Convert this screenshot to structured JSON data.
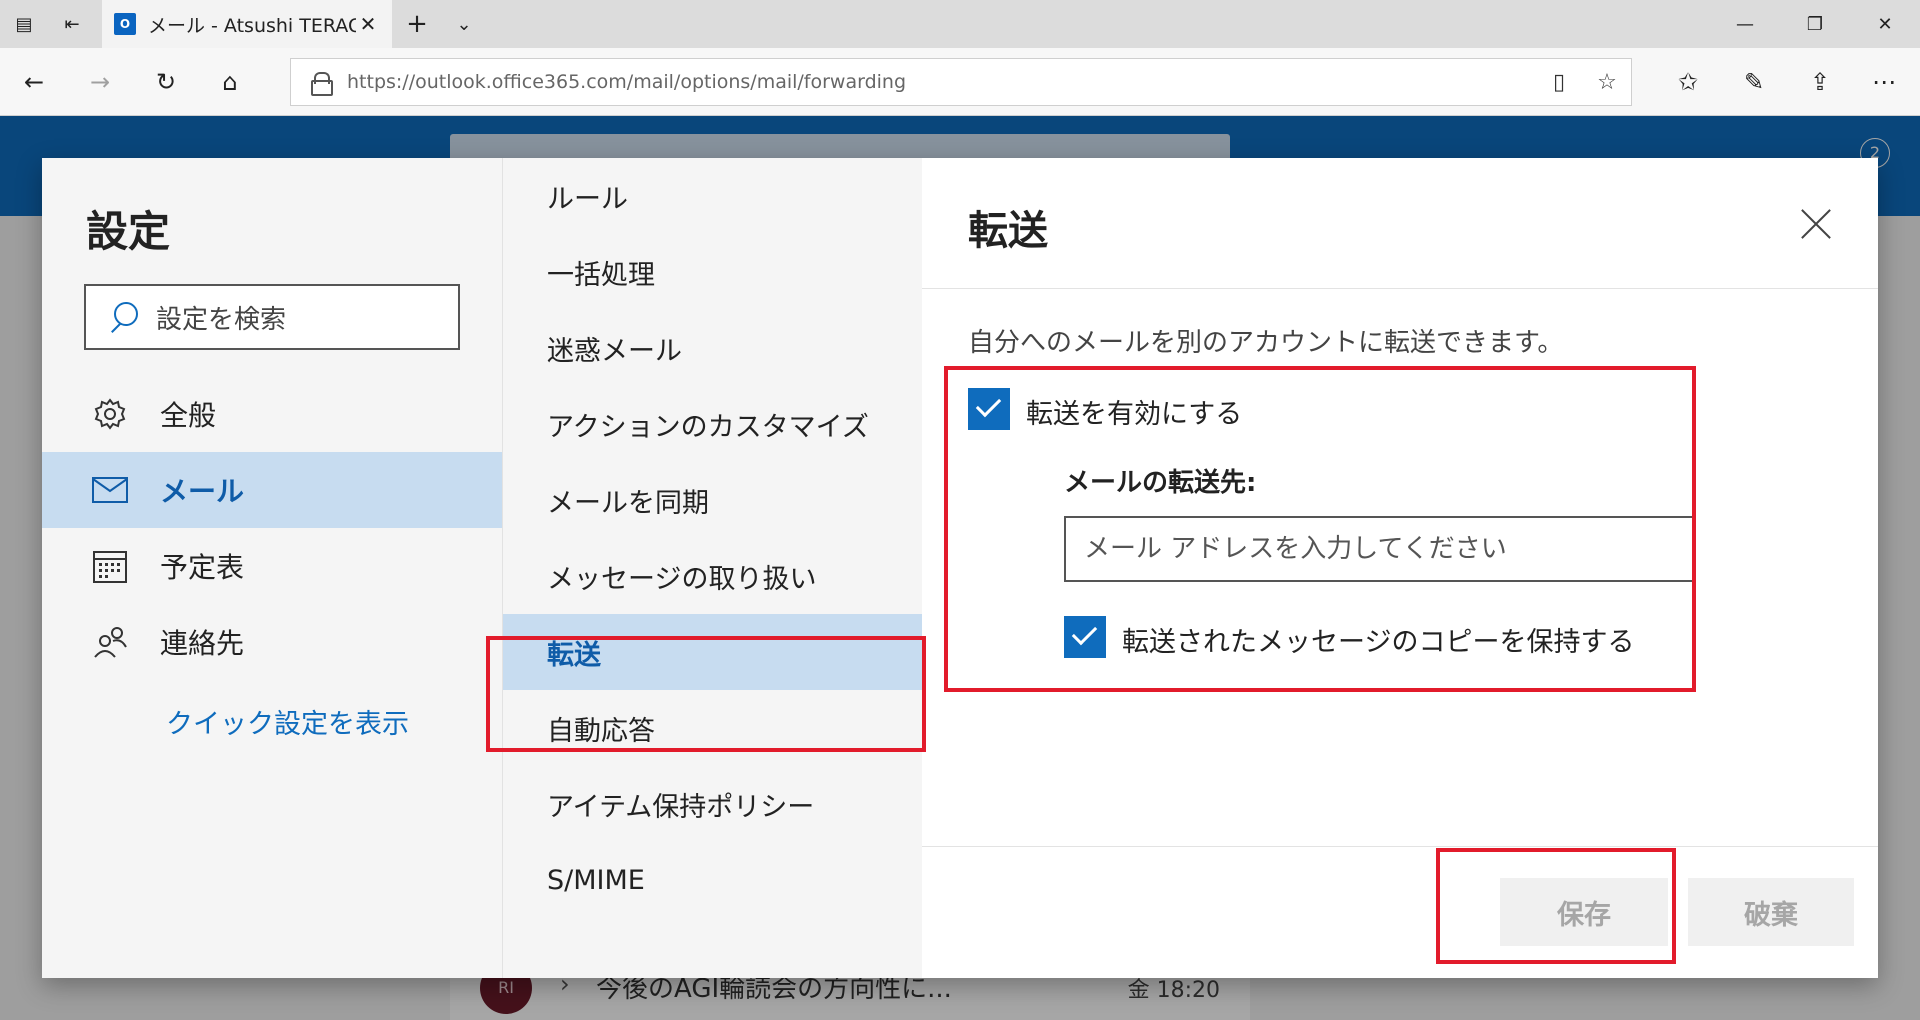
{
  "browser": {
    "tab_title": "メール - Atsushi TERAO -",
    "tab_favicon": "O",
    "url": "https://outlook.office365.com/mail/options/mail/forwarding"
  },
  "outlook_bg": {
    "notification_count": "2",
    "mail_item": {
      "avatar": "RI",
      "subject": "今後のAGI輪読会の方向性に...",
      "time": "金 18:20"
    }
  },
  "settings": {
    "title": "設定",
    "search_placeholder": "設定を検索",
    "categories": [
      {
        "label": "全般",
        "icon": "gear-icon"
      },
      {
        "label": "メール",
        "icon": "mail-icon"
      },
      {
        "label": "予定表",
        "icon": "calendar-icon"
      },
      {
        "label": "連絡先",
        "icon": "people-icon"
      }
    ],
    "active_category": "メール",
    "quick_settings_link": "クイック設定を表示",
    "subcategories": [
      "ルール",
      "一括処理",
      "迷惑メール",
      "アクションのカスタマイズ",
      "メールを同期",
      "メッセージの取り扱い",
      "転送",
      "自動応答",
      "アイテム保持ポリシー",
      "S/MIME"
    ],
    "active_subcategory": "転送"
  },
  "forwarding": {
    "title": "転送",
    "description": "自分へのメールを別のアカウントに転送できます。",
    "enable_label": "転送を有効にする",
    "enable_checked": true,
    "to_label": "メールの転送先:",
    "to_placeholder": "メール アドレスを入力してください",
    "to_value": "",
    "keep_copy_label": "転送されたメッセージのコピーを保持する",
    "keep_copy_checked": true,
    "save_label": "保存",
    "discard_label": "破棄"
  },
  "colors": {
    "brand": "#0f6cbd",
    "selection": "#c7dcf0",
    "annotation": "#e21b2b"
  }
}
